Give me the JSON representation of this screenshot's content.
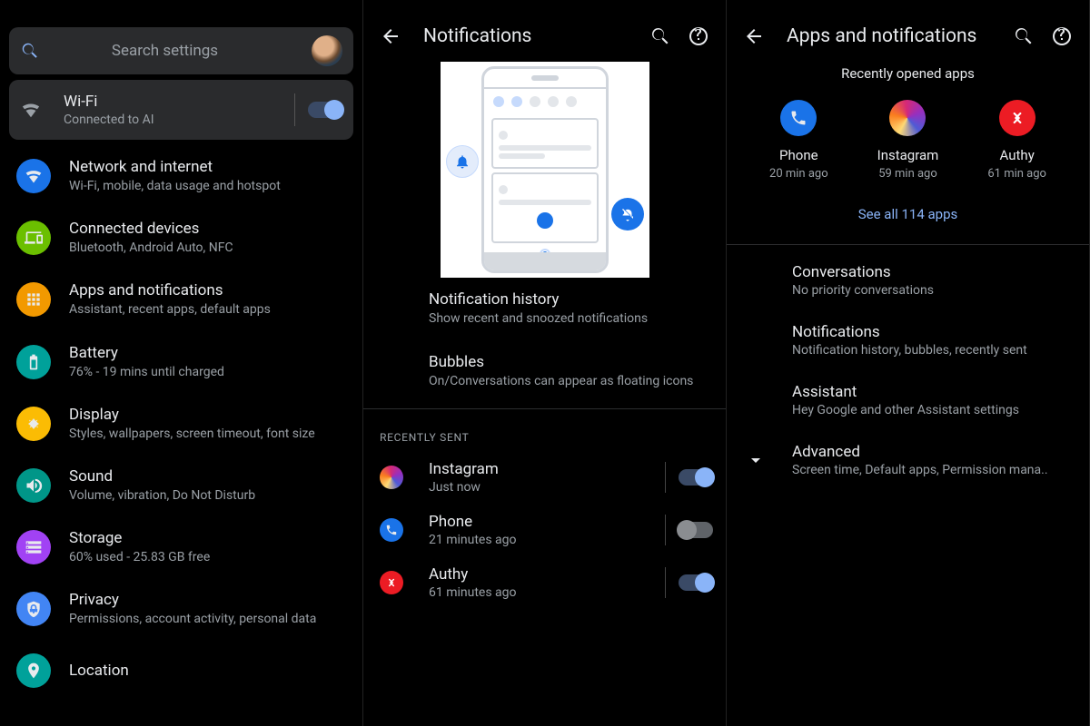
{
  "panel1": {
    "search_placeholder": "Search settings",
    "wifi": {
      "title": "Wi-Fi",
      "sub": "Connected to AI",
      "on": true
    },
    "items": [
      {
        "title": "Network and internet",
        "sub": "Wi-Fi, mobile, data usage and hotspot",
        "color": "blue",
        "icon": "wifi"
      },
      {
        "title": "Connected devices",
        "sub": "Bluetooth, Android Auto, NFC",
        "color": "green",
        "icon": "devices"
      },
      {
        "title": "Apps and notifications",
        "sub": "Assistant, recent apps, default apps",
        "color": "orange",
        "icon": "apps"
      },
      {
        "title": "Battery",
        "sub": "76% - 19 mins until charged",
        "color": "teal",
        "icon": "battery"
      },
      {
        "title": "Display",
        "sub": "Styles, wallpapers, screen timeout, font size",
        "color": "yellow",
        "icon": "display"
      },
      {
        "title": "Sound",
        "sub": "Volume, vibration, Do Not Disturb",
        "color": "teal2",
        "icon": "sound"
      },
      {
        "title": "Storage",
        "sub": "60% used - 25.83 GB free",
        "color": "purple",
        "icon": "storage"
      },
      {
        "title": "Privacy",
        "sub": "Permissions, account activity, personal data",
        "color": "lblue",
        "icon": "privacy"
      },
      {
        "title": "Location",
        "sub": "",
        "color": "teal",
        "icon": "location"
      }
    ]
  },
  "panel2": {
    "title": "Notifications",
    "rows": [
      {
        "title": "Notification history",
        "sub": "Show recent and snoozed notifications"
      },
      {
        "title": "Bubbles",
        "sub": "On/Conversations can appear as floating icons"
      }
    ],
    "section_label": "Recently sent",
    "recent": [
      {
        "name": "Instagram",
        "ago": "Just now",
        "icon": "ig",
        "on": true
      },
      {
        "name": "Phone",
        "ago": "21 minutes ago",
        "icon": "ph",
        "on": false
      },
      {
        "name": "Authy",
        "ago": "61 minutes ago",
        "icon": "au",
        "on": true
      }
    ]
  },
  "panel3": {
    "title": "Apps and notifications",
    "recent_header": "Recently opened apps",
    "apps": [
      {
        "name": "Phone",
        "ago": "20 min ago",
        "icon": "ph"
      },
      {
        "name": "Instagram",
        "ago": "59 min ago",
        "icon": "ig"
      },
      {
        "name": "Authy",
        "ago": "61 min ago",
        "icon": "au"
      }
    ],
    "see_all": "See all 114 apps",
    "rows": [
      {
        "title": "Conversations",
        "sub": "No priority conversations"
      },
      {
        "title": "Notifications",
        "sub": "Notification history, bubbles, recently sent"
      },
      {
        "title": "Assistant",
        "sub": "Hey Google and other Assistant settings"
      }
    ],
    "advanced": {
      "title": "Advanced",
      "sub": "Screen time, Default apps, Permission mana.."
    }
  }
}
